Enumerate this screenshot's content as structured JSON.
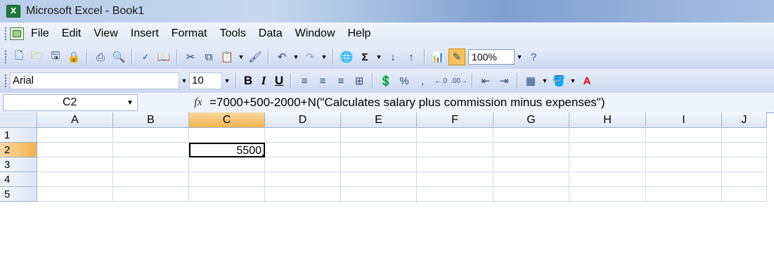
{
  "window": {
    "title": "Microsoft Excel - Book1"
  },
  "menu": [
    {
      "label": "File",
      "key": "F"
    },
    {
      "label": "Edit",
      "key": "E"
    },
    {
      "label": "View",
      "key": "V"
    },
    {
      "label": "Insert",
      "key": "I"
    },
    {
      "label": "Format",
      "key": "o"
    },
    {
      "label": "Tools",
      "key": "T"
    },
    {
      "label": "Data",
      "key": "D"
    },
    {
      "label": "Window",
      "key": "W"
    },
    {
      "label": "Help",
      "key": "H"
    }
  ],
  "standard_toolbar": {
    "zoom": "100%"
  },
  "formatting_toolbar": {
    "font": "Arial",
    "size": "10",
    "percent": "%",
    "comma": ","
  },
  "formula_bar": {
    "name_box": "C2",
    "fx_label": "fx",
    "formula": "=7000+500-2000+N(\"Calculates salary plus commission minus expenses\")"
  },
  "sheet": {
    "columns": [
      "A",
      "B",
      "C",
      "D",
      "E",
      "F",
      "G",
      "H",
      "I",
      "J"
    ],
    "rows": [
      "1",
      "2",
      "3",
      "4",
      "5"
    ],
    "active_cell": "C2",
    "cells": {
      "C2": "5500"
    }
  },
  "colors": {
    "active_header": "#f1b44f",
    "title_bar": "#7f9fd0"
  }
}
